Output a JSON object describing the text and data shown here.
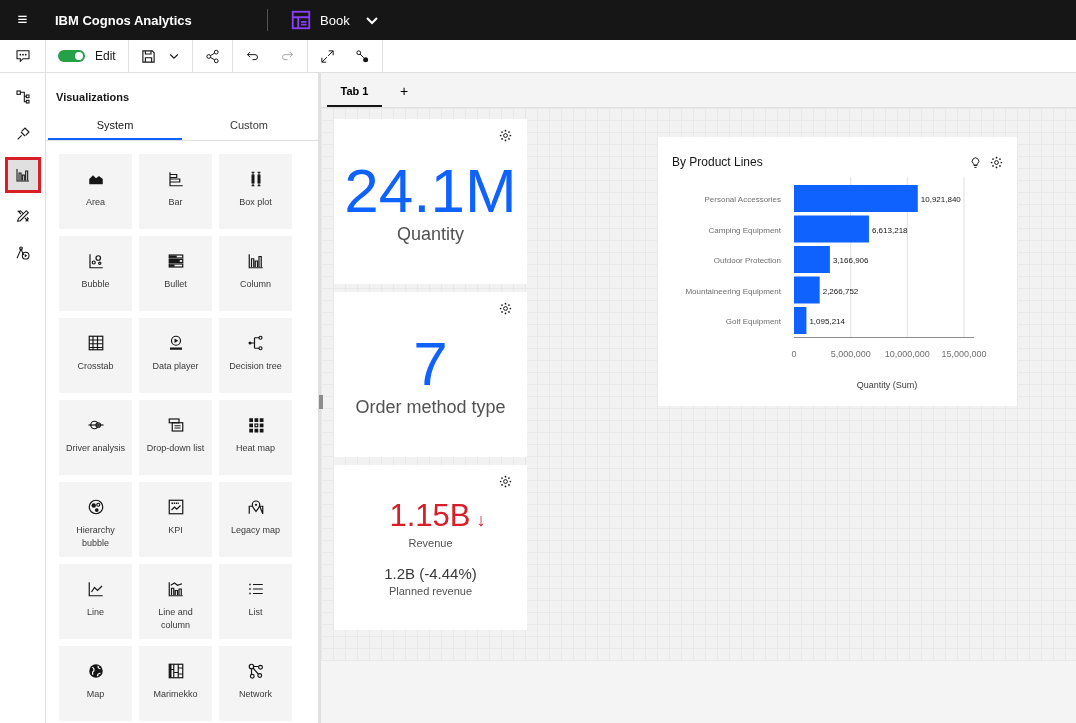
{
  "topbar": {
    "menu_icon": "≡",
    "title": "IBM Cognos Analytics",
    "document": "Book"
  },
  "toolbar": {
    "edit": {
      "label": "Edit",
      "on": true
    }
  },
  "rail": [
    {
      "selected": false
    },
    {
      "selected": false
    },
    {
      "selected": true
    },
    {
      "selected": false
    },
    {
      "selected": false
    }
  ],
  "panel": {
    "title": "Visualizations",
    "tabs": [
      {
        "label": "System",
        "selected": true
      },
      {
        "label": "Custom",
        "selected": false
      }
    ],
    "tiles": [
      {
        "label": "Area"
      },
      {
        "label": "Bar"
      },
      {
        "label": "Box plot"
      },
      {
        "label": "Bubble"
      },
      {
        "label": "Bullet"
      },
      {
        "label": "Column"
      },
      {
        "label": "Crosstab"
      },
      {
        "label": "Data player"
      },
      {
        "label": "Decision tree"
      },
      {
        "label": "Driver analysis"
      },
      {
        "label": "Drop-down list"
      },
      {
        "label": "Heat map"
      },
      {
        "label": "Hierarchy bubble"
      },
      {
        "label": "KPI"
      },
      {
        "label": "Legacy map"
      },
      {
        "label": "Line"
      },
      {
        "label": "Line and column"
      },
      {
        "label": "List"
      },
      {
        "label": "Map"
      },
      {
        "label": "Marimekko"
      },
      {
        "label": "Network"
      }
    ]
  },
  "doc_tabs": [
    {
      "label": "Tab 1",
      "selected": true
    }
  ],
  "add_tab": "+",
  "cards": [
    {
      "kind": "big",
      "value": "24.1M",
      "color": "#0f62fe",
      "label": "Quantity"
    },
    {
      "kind": "big",
      "value": "7",
      "color": "#0f62fe",
      "label": "Order method type"
    },
    {
      "kind": "kpi",
      "value": "1.15B",
      "color": "#da1e28",
      "trend_arrow": "↓",
      "label": "Revenue",
      "target": "1.2B (-4.44%)",
      "target_label": "Planned revenue"
    }
  ],
  "chart_card": {
    "title": "By Product Lines",
    "chart_data": {
      "type": "bar",
      "orientation": "horizontal",
      "xlabel": "Quantity (Sum)",
      "categories": [
        "Personal Accessories",
        "Camping Equipment",
        "Outdoor Protection",
        "Mountaineering Equipment",
        "Golf Equipment"
      ],
      "series": [
        {
          "color": "#0f62fe",
          "values": [
            10921840,
            6613218,
            3166906,
            2266752,
            1095214
          ]
        }
      ],
      "value_labels": [
        "10,921,840",
        "6,613,218",
        "3,166,906",
        "2,266,752",
        "1,095,214"
      ],
      "xlim": [
        0,
        15000000
      ],
      "xticks": [
        {
          "value": 0,
          "label": "0"
        },
        {
          "value": 5000000,
          "label": "5,000,000"
        },
        {
          "value": 10000000,
          "label": "10,000,000"
        },
        {
          "value": 15000000,
          "label": "15,000,000"
        }
      ]
    }
  }
}
